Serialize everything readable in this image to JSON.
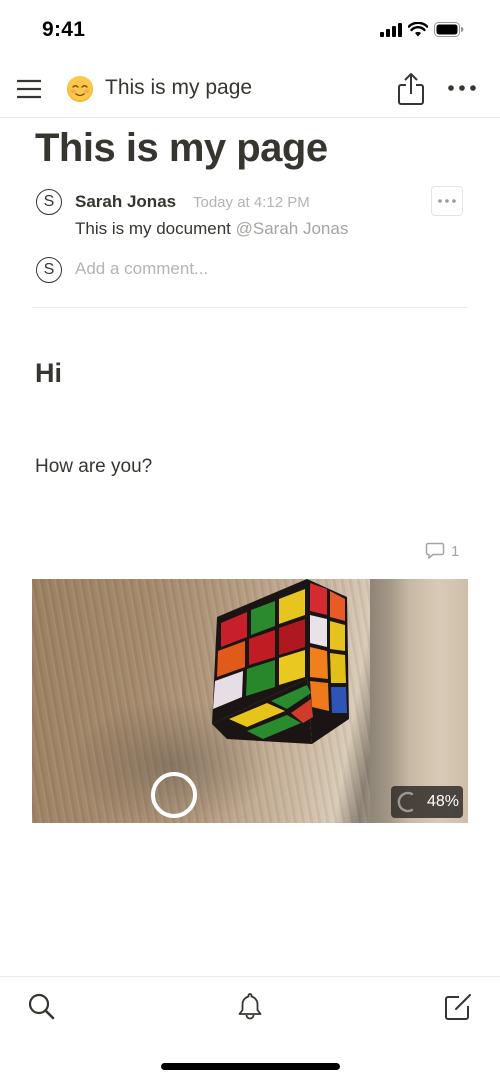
{
  "status_bar": {
    "time": "9:41",
    "icons": [
      "cellular-signal-icon",
      "wifi-icon",
      "battery-icon"
    ]
  },
  "nav_bar": {
    "menu_icon": "hamburger-menu-icon",
    "page_emoji": "😊",
    "title": "This is my page",
    "share_icon": "share-icon",
    "more_icon": "ellipsis-icon"
  },
  "page": {
    "title": "This is my page",
    "comment": {
      "avatar_initial": "S",
      "author": "Sarah Jonas",
      "time": "Today at 4:12 PM",
      "text": "This is my document",
      "mention": "@Sarah Jonas"
    },
    "add_comment": {
      "avatar_initial": "S",
      "placeholder": "Add a comment..."
    },
    "blocks": {
      "heading": "Hi",
      "paragraph": "How are you?"
    },
    "block_comment_count": "1",
    "image": {
      "description": "Rubik's cube on wooden surface",
      "upload_progress_label": "48%",
      "upload_progress": 0.48
    }
  },
  "bottom_bar": {
    "items": [
      {
        "name": "search",
        "icon": "search-icon"
      },
      {
        "name": "notifications",
        "icon": "bell-icon"
      },
      {
        "name": "new-page",
        "icon": "compose-icon"
      }
    ]
  },
  "colors": {
    "text": "#37352f",
    "muted": "#b5b4b1",
    "divider": "#e9e9e7"
  }
}
